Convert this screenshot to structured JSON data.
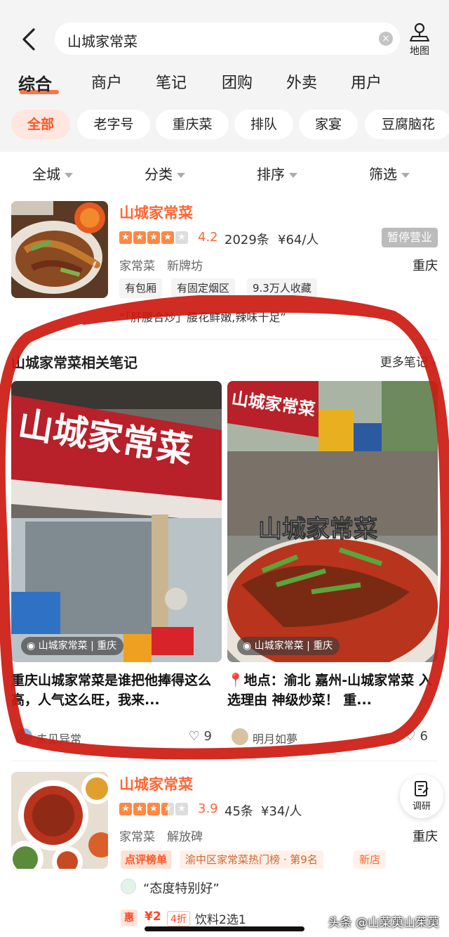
{
  "search": {
    "query": "山城家常菜",
    "map_label": "地图"
  },
  "tabs": [
    {
      "label": "综合",
      "active": true
    },
    {
      "label": "商户"
    },
    {
      "label": "笔记"
    },
    {
      "label": "团购"
    },
    {
      "label": "外卖"
    },
    {
      "label": "用户"
    }
  ],
  "chips": [
    "全部",
    "老字号",
    "重庆菜",
    "排队",
    "家宴",
    "豆腐脑花"
  ],
  "filters": [
    "全城",
    "分类",
    "排序",
    "筛选"
  ],
  "shop1": {
    "name": "山城家常菜",
    "stars": 4,
    "score": "4.2",
    "reviews": "2029条",
    "price": "¥64/人",
    "status": "暂停营业",
    "category": "家常菜",
    "area": "新牌坊",
    "city": "重庆",
    "tags": [
      "有包厢",
      "有固定烟区",
      "9.3万人收藏"
    ],
    "quote": "“「肝腰合炒」腰花鲜嫩,辣味十足”"
  },
  "notes": {
    "header": "山城家常菜相关笔记",
    "more": "更多笔记",
    "items": [
      {
        "location": "山城家常菜 | 重庆",
        "title": "重庆山城家常菜是谁把他捧得这么高，人气这么旺，我来...",
        "author": "未见异常",
        "likes": "9",
        "overlay": "",
        "sign": "山城家常菜"
      },
      {
        "location": "山城家常菜 | 重庆",
        "title": "📍地点：渝北 嘉州-山城家常菜 入选理由 神级炒菜！ 重...",
        "author": "明月如夢",
        "likes": "6",
        "overlay": "山城家常菜",
        "sign": "山城家常菜"
      }
    ]
  },
  "shop2": {
    "name": "山城家常菜",
    "stars": 3.5,
    "score": "3.9",
    "reviews": "45条",
    "price": "¥34/人",
    "category": "家常菜",
    "area": "解放碑",
    "city": "重庆",
    "rank_label": "点评榜单",
    "rank_text": "渝中区家常菜热门榜 · 第9名",
    "new_label": "新店",
    "review_quote": "“态度特别好”",
    "deal_badge": "惠",
    "deal_price": "¥2",
    "deal_discount": "4折",
    "deal_text": "饮料2选1"
  },
  "research_label": "调研",
  "watermark": "头条 @山菜萸山茱萸",
  "colors": {
    "accent": "#ff6633",
    "annotation": "#cc1a10"
  }
}
